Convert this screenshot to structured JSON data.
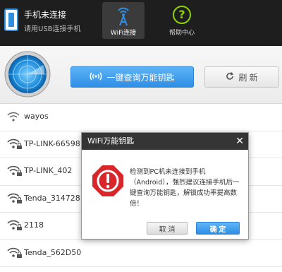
{
  "header": {
    "title": "手机未连接",
    "subtitle": "请用USB连接手机",
    "tabs": [
      {
        "label": "WiFi连接",
        "active": true
      },
      {
        "label": "帮助中心",
        "active": false
      }
    ]
  },
  "actions": {
    "query_label": "一键查询万能钥匙",
    "refresh_label": "刷 新"
  },
  "wifi_list": [
    {
      "ssid": "wayos",
      "locked": false
    },
    {
      "ssid": "TP-LINK-66598",
      "locked": true
    },
    {
      "ssid": "TP-LINK_402",
      "locked": true
    },
    {
      "ssid": "Tenda_314728",
      "locked": true
    },
    {
      "ssid": "2118",
      "locked": true
    },
    {
      "ssid": "Tenda_562D50",
      "locked": true
    }
  ],
  "dialog": {
    "title": "WiFi万能钥匙",
    "message": "检测到PC机未连接到手机（Android），强烈建议连接手机后一键查询万能钥匙，解锁成功率提高数倍！",
    "cancel_label": "取 消",
    "ok_label": "确 定"
  },
  "colors": {
    "topbar": "#1e1e1e",
    "accent": "#2f8fe6",
    "help_green": "#8fd400",
    "alert_red": "#d9262b"
  }
}
